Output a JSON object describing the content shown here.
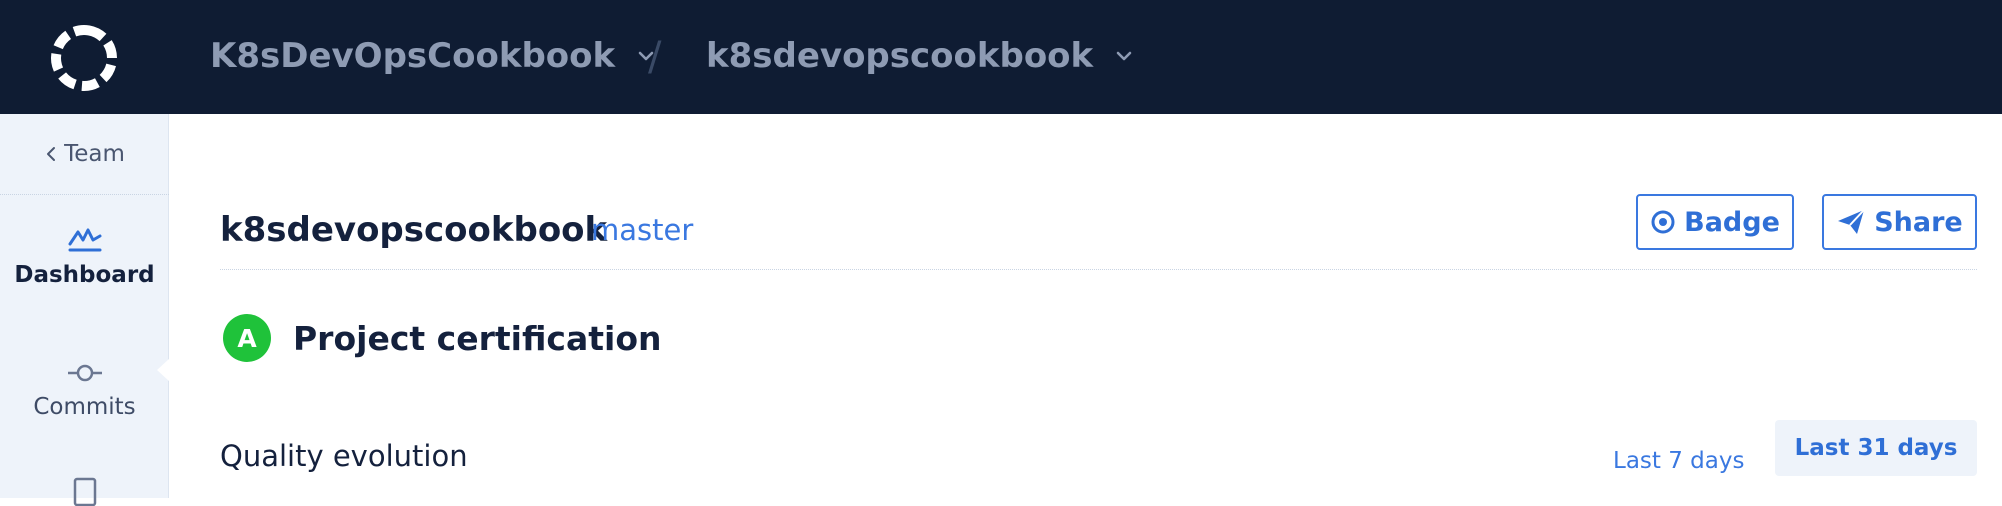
{
  "header": {
    "org_name": "K8sDevOpsCookbook",
    "separator": "/",
    "repo_name": "k8sdevopscookbook",
    "logo_icon": "codacy-logo-icon",
    "chevron_icon": "chevron-down-icon"
  },
  "sidebar": {
    "back_label": "Team",
    "items": [
      {
        "label": "Dashboard",
        "icon": "dashboard-chart-icon",
        "active": true
      },
      {
        "label": "Commits",
        "icon": "commit-icon",
        "active": false
      },
      {
        "label": "",
        "icon": "file-icon",
        "active": false
      }
    ]
  },
  "project": {
    "title": "k8sdevopscookbook",
    "branch": "master",
    "badge_label": "Badge",
    "share_label": "Share"
  },
  "certification": {
    "grade": "A",
    "title": "Project certification",
    "grade_color": "#1fc23a"
  },
  "quality": {
    "title": "Quality evolution",
    "range_options": [
      "Last 7 days",
      "Last 31 days"
    ],
    "selected_range": "Last 31 days"
  },
  "colors": {
    "topbar": "#0f1c33",
    "accent": "#3a78e0",
    "sidebar_bg": "#eef3fa"
  }
}
